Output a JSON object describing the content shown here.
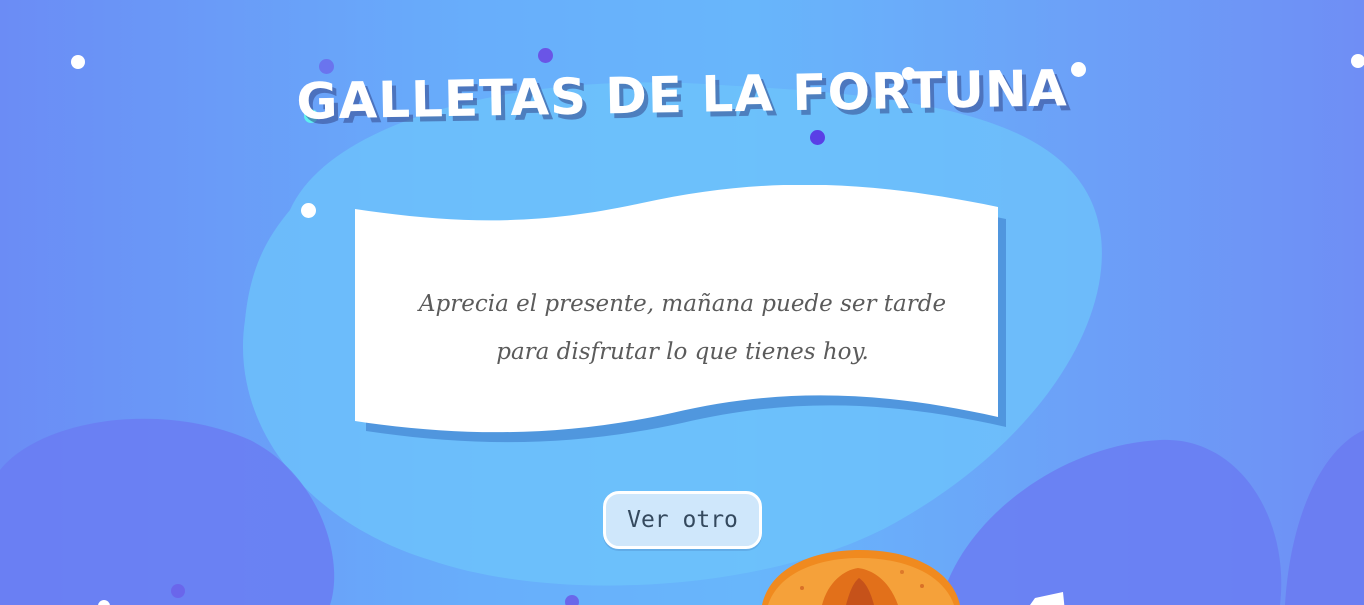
{
  "page": {
    "title": "GALLETAS DE LA FORTUNA",
    "fortune": "Aprecia el presente, mañana puede ser tarde para disfrutar lo que tienes hoy.",
    "button_label": "Ver otro"
  },
  "colors": {
    "background_left": "#6b8cf5",
    "background_center": "#68b6fb",
    "blob_light": "#6ec4fb",
    "blob_dark": "#6a7cf2",
    "paper": "#ffffff",
    "paper_shadow": "#4b8fd8",
    "text": "#5b5b5b",
    "button_bg": "#cfe7fb",
    "button_text": "#34495e",
    "cookie_orange": "#f08a1f"
  },
  "icons": {
    "cookie": "fortune-cookie-icon",
    "paper": "paper-scroll-icon"
  }
}
